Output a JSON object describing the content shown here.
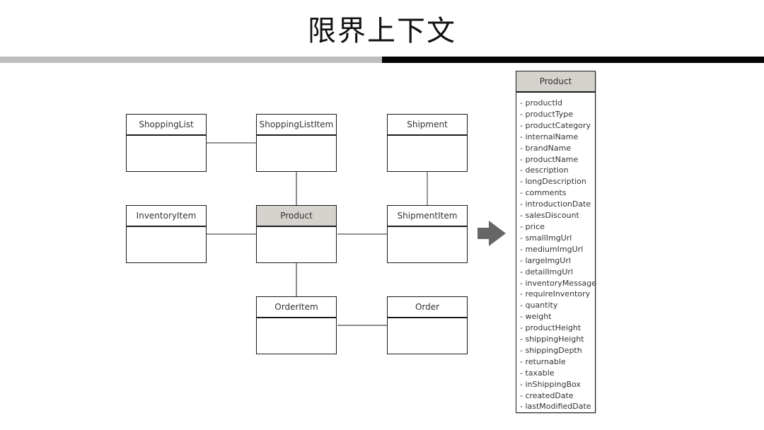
{
  "slide": {
    "title": "限界上下文"
  },
  "diagram": {
    "entities": [
      {
        "id": "shopping-list",
        "name": "ShoppingList",
        "highlighted": false
      },
      {
        "id": "shopping-list-item",
        "name": "ShoppingListItem",
        "highlighted": false
      },
      {
        "id": "shipment",
        "name": "Shipment",
        "highlighted": false
      },
      {
        "id": "inventory-item",
        "name": "InventoryItem",
        "highlighted": false
      },
      {
        "id": "product",
        "name": "Product",
        "highlighted": true
      },
      {
        "id": "shipment-item",
        "name": "ShipmentItem",
        "highlighted": false
      },
      {
        "id": "order-item",
        "name": "OrderItem",
        "highlighted": false
      },
      {
        "id": "order",
        "name": "Order",
        "highlighted": false
      }
    ],
    "relations": [
      [
        "ShoppingList",
        "ShoppingListItem"
      ],
      [
        "ShoppingListItem",
        "Product"
      ],
      [
        "Shipment",
        "ShipmentItem"
      ],
      [
        "InventoryItem",
        "Product"
      ],
      [
        "Product",
        "ShipmentItem"
      ],
      [
        "Product",
        "OrderItem"
      ],
      [
        "OrderItem",
        "Order"
      ]
    ],
    "arrow_icon": "right-arrow-icon",
    "detail": {
      "name": "Product",
      "attributes": [
        "- productId",
        "- productType",
        "- productCategory",
        "- internalName",
        "- brandName",
        "- productName",
        "- description",
        "- longDescription",
        "- comments",
        "- introductionDate",
        "- salesDiscount",
        "- price",
        "- smallImgUrl",
        "- mediumImgUrl",
        "- largeImgUrl",
        "- detailImgUrl",
        "- inventoryMessage",
        "- requireInventory",
        "- quantity",
        "- weight",
        "- productHeight",
        "- shippingHeight",
        "- shippingDepth",
        "- returnable",
        "- taxable",
        "- inShippingBox",
        "- createdDate",
        "- lastModifiedDate"
      ]
    }
  },
  "colors": {
    "highlight_header": "#d6d2cd",
    "divider_gray": "#bdbdbd",
    "divider_black": "#050505",
    "arrow": "#666666"
  }
}
